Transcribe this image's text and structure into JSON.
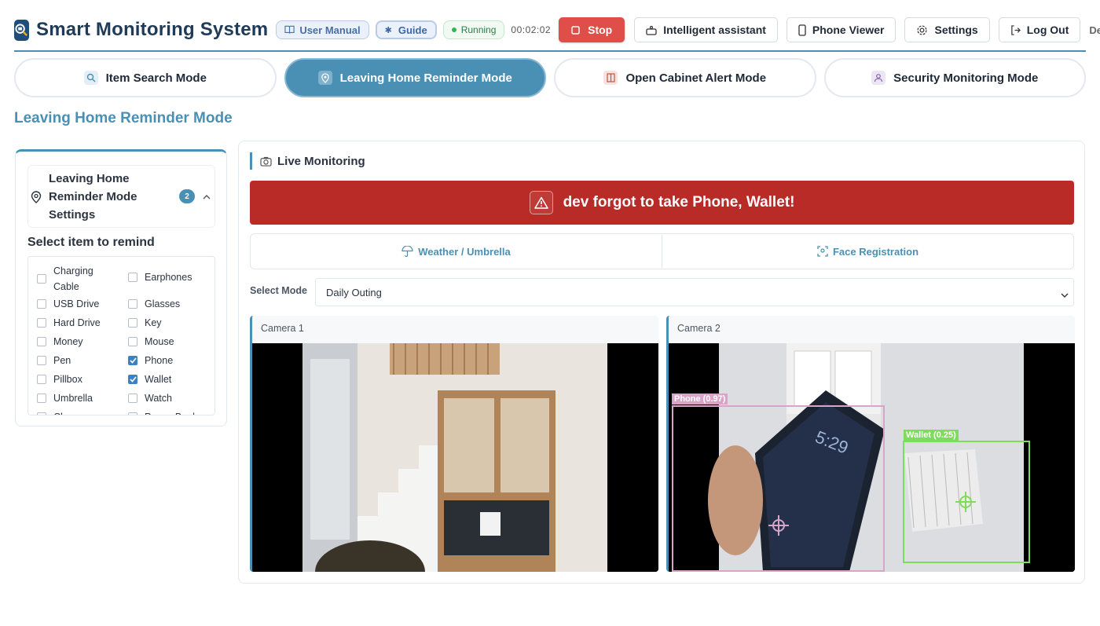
{
  "header": {
    "title": "Smart Monitoring System",
    "logo_icon": "camera-search-icon",
    "user_manual": "User Manual",
    "guide": "Guide",
    "status": "Running",
    "timer": "00:02:02",
    "stop": "Stop",
    "assistant": "Intelligent assistant",
    "phone_viewer": "Phone Viewer",
    "settings": "Settings",
    "logout": "Log Out",
    "user": "Developer"
  },
  "modes": [
    {
      "label": "Item Search Mode",
      "icon": "search-icon",
      "active": false
    },
    {
      "label": "Leaving Home Reminder Mode",
      "icon": "location-pin-icon",
      "active": true
    },
    {
      "label": "Open Cabinet Alert Mode",
      "icon": "cabinet-icon",
      "active": false
    },
    {
      "label": "Security Monitoring Mode",
      "icon": "user-shield-icon",
      "active": false
    }
  ],
  "page_title": "Leaving Home Reminder Mode",
  "left": {
    "settings_title": "Leaving Home Reminder Mode Settings",
    "badge": "2",
    "select_label": "Select item to remind",
    "items": [
      {
        "label": "Charging Cable",
        "checked": false
      },
      {
        "label": "Earphones",
        "checked": false
      },
      {
        "label": "USB Drive",
        "checked": false
      },
      {
        "label": "Glasses",
        "checked": false
      },
      {
        "label": "Hard Drive",
        "checked": false
      },
      {
        "label": "Key",
        "checked": false
      },
      {
        "label": "Money",
        "checked": false
      },
      {
        "label": "Mouse",
        "checked": false
      },
      {
        "label": "Pen",
        "checked": false
      },
      {
        "label": "Phone",
        "checked": true
      },
      {
        "label": "Pillbox",
        "checked": false
      },
      {
        "label": "Wallet",
        "checked": true
      },
      {
        "label": "Umbrella",
        "checked": false
      },
      {
        "label": "Watch",
        "checked": false
      },
      {
        "label": "Charger",
        "checked": false
      },
      {
        "label": "Power Bank",
        "checked": false
      }
    ]
  },
  "right": {
    "live_title": "Live Monitoring",
    "alert_text": "dev forgot to take Phone, Wallet!",
    "tabs": [
      {
        "label": "Weather / Umbrella",
        "icon": "umbrella-icon"
      },
      {
        "label": "Face Registration",
        "icon": "face-scan-icon"
      }
    ],
    "select_mode_label": "Select Mode",
    "select_mode_value": "Daily Outing",
    "cameras": [
      {
        "label": "Camera 1"
      },
      {
        "label": "Camera 2",
        "detections": [
          {
            "label": "Phone (0.97)",
            "color": "#d9a4c8"
          },
          {
            "label": "Wallet (0.25)",
            "color": "#7ddc5a"
          }
        ]
      }
    ]
  },
  "colors": {
    "accent": "#4a90b5",
    "alert": "#b92b27",
    "stop": "#e04e4a",
    "checked": "#3b82c4"
  }
}
